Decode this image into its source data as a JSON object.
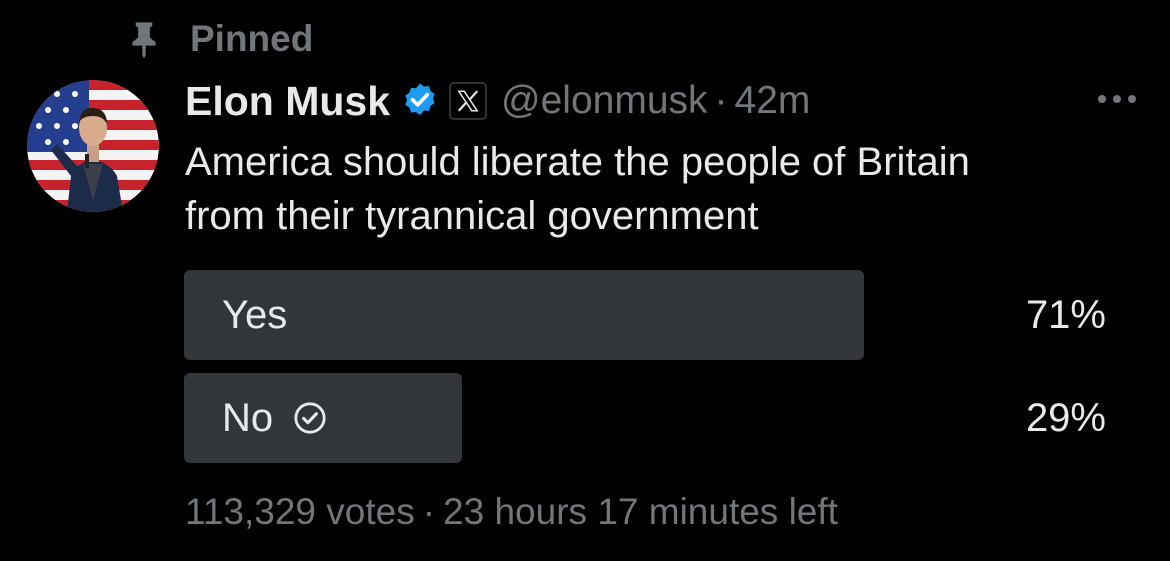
{
  "pinned": {
    "label": "Pinned",
    "icon": "pin-icon"
  },
  "tweet": {
    "author": {
      "name": "Elon Musk",
      "handle": "@elonmusk",
      "avatar_icon": "avatar",
      "verified_icon": "verified-badge-icon",
      "affiliate_icon": "x-logo-icon"
    },
    "separator": "·",
    "timestamp": "42m",
    "more_icon": "more-horizontal-icon",
    "text_lines": [
      "America should liberate the people of Britain",
      "from their tyrannical government"
    ],
    "poll": {
      "options": [
        {
          "label": "Yes",
          "percent_text": "71%",
          "percent": 71,
          "selected": false
        },
        {
          "label": "No",
          "percent_text": "29%",
          "percent": 29,
          "selected": true,
          "check_icon": "check-circle-icon"
        }
      ],
      "votes": "113,329 votes",
      "separator": "·",
      "time_left": "23 hours 17 minutes left"
    }
  },
  "colors": {
    "background": "#000000",
    "primary_text": "#e7e9ea",
    "secondary_text": "#71767b",
    "poll_fill": "#333639",
    "verified_blue": "#1d9bf0"
  }
}
